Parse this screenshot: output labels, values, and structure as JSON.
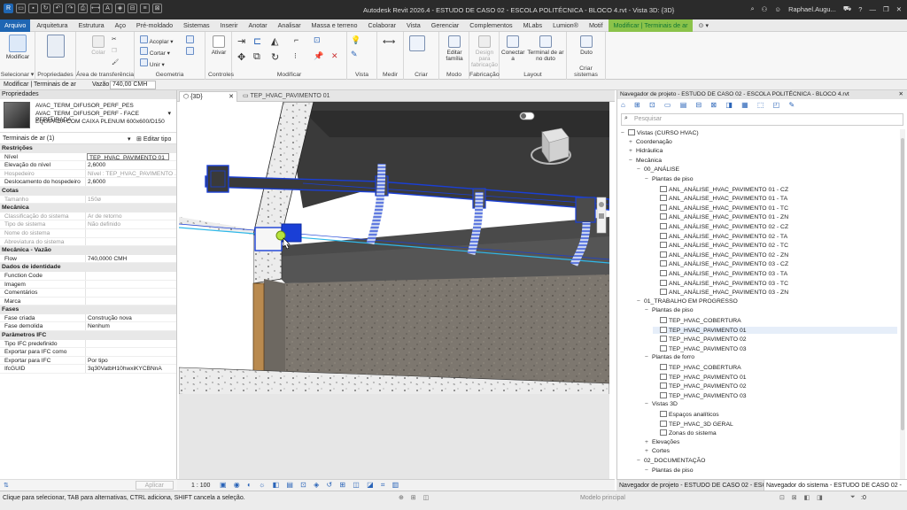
{
  "window": {
    "title": "Autodesk Revit 2026.4 - ESTUDO DE CASO 02 - ESCOLA POLITÉCNICA - BLOCO 4.rvt - Vista 3D: {3D}",
    "user": "Raphael.Augu..."
  },
  "menu": {
    "tabs": [
      "Arquivo",
      "Arquitetura",
      "Estrutura",
      "Aço",
      "Pré-moldado",
      "Sistemas",
      "Inserir",
      "Anotar",
      "Analisar",
      "Massa e terreno",
      "Colaborar",
      "Vista",
      "Gerenciar",
      "Complementos",
      "MLabs",
      "Lumion®",
      "Motif",
      "Modificar | Terminais de ar"
    ]
  },
  "ribbon": {
    "modify": "Modificar",
    "select": "Selecionar",
    "properties": "Propriedades",
    "clipboard": "Área de transferência",
    "geometry": "Geometria",
    "controls": "Controles",
    "modify_group": "Modificar",
    "view": "Vista",
    "measure": "Medir",
    "create": "Criar",
    "mode": "Modo",
    "fabrication": "Fabricação",
    "layout": "Layout",
    "create_systems": "Criar sistemas",
    "cut": "Cortar",
    "join": "Unir",
    "paste": "Colar",
    "copy": "Acoplar",
    "activate": "Ativar",
    "edit_family": "Editar família",
    "design_fab": "Design para fabricação",
    "connect_to": "Conectar a",
    "terminal_duct": "Terminal de ar no duto",
    "duct": "Duto"
  },
  "optionbar": {
    "context": "Modificar | Terminais de ar",
    "flow_label": "Vazão:",
    "flow_value": "740,00 CMH"
  },
  "properties": {
    "panel_title": "Propriedades",
    "family_line1": "AVAC_TERM_DIFUSOR_PERF_PES",
    "family_line2": "AVAC_TERM_DIFUSOR_PERF - FACE PERFURADA",
    "family_line3": "EQUIPADA COM CAIXA PLENUM 600x600/D150",
    "instance_filter": "Terminais de ar (1)",
    "edit_type": "Editar tipo",
    "rows": [
      {
        "type": "section",
        "k": "Restrições"
      },
      {
        "k": "Nível",
        "v": "TEP_HVAC_PAVIMENTO 01",
        "box": true
      },
      {
        "k": "Elevação do nível",
        "v": "2,6000"
      },
      {
        "k": "Hospedeiro",
        "v": "Nível : TEP_HVAC_PAVIMENTO ...",
        "dis": true
      },
      {
        "k": "Deslocamento do hospedeiro",
        "v": "2,6000"
      },
      {
        "type": "section",
        "k": "Cotas"
      },
      {
        "k": "Tamanho",
        "v": "150ø",
        "dis": true
      },
      {
        "type": "section",
        "k": "Mecânica"
      },
      {
        "k": "Classificação do sistema",
        "v": "Ar de retorno",
        "dis": true
      },
      {
        "k": "Tipo de sistema",
        "v": "Não definido",
        "dis": true
      },
      {
        "k": "Nome do sistema",
        "v": "",
        "dis": true
      },
      {
        "k": "Abreviatura do sistema",
        "v": "",
        "dis": true
      },
      {
        "type": "section",
        "k": "Mecânica - Vazão"
      },
      {
        "k": "Flow",
        "v": "740,0000 CMH"
      },
      {
        "type": "section",
        "k": "Dados de identidade"
      },
      {
        "k": "Function Code",
        "v": ""
      },
      {
        "k": "Imagem",
        "v": ""
      },
      {
        "k": "Comentários",
        "v": ""
      },
      {
        "k": "Marca",
        "v": ""
      },
      {
        "type": "section",
        "k": "Fases"
      },
      {
        "k": "Fase criada",
        "v": "Construção nova"
      },
      {
        "k": "Fase demolida",
        "v": "Nenhum"
      },
      {
        "type": "section",
        "k": "Parâmetros IFC"
      },
      {
        "k": "Tipo IFC predefinido",
        "v": ""
      },
      {
        "k": "Exportar para IFC como",
        "v": ""
      },
      {
        "k": "Exportar para IFC",
        "v": "Por tipo"
      },
      {
        "k": "IfcGUID",
        "v": "3q30VatbH10hwxiKYCBNnA"
      }
    ],
    "apply": "Aplicar"
  },
  "views": {
    "tab1": "{3D}",
    "tab2": "TEP_HVAC_PAVIMENTO 01",
    "scale": "1 : 100"
  },
  "browser": {
    "title": "Navegador de projeto - ESTUDO DE CASO 02 - ESCOLA POLITÉCNICA - BLOCO 4.rvt",
    "search_placeholder": "Pesquisar",
    "nodes": [
      {
        "lvl": 0,
        "exp": "−",
        "t": "Vistas (CURSO HVAC)",
        "ico": true
      },
      {
        "lvl": 1,
        "exp": "+",
        "t": "Coordenação"
      },
      {
        "lvl": 1,
        "exp": "+",
        "t": "Hidráulica"
      },
      {
        "lvl": 1,
        "exp": "−",
        "t": "Mecânica"
      },
      {
        "lvl": 2,
        "exp": "−",
        "t": "00_ANÁLISE"
      },
      {
        "lvl": 3,
        "exp": "−",
        "t": "Plantas de piso"
      },
      {
        "lvl": 4,
        "exp": "",
        "t": "ANL_ANÁLISE_HVAC_PAVIMENTO 01 - CZ",
        "ico": true
      },
      {
        "lvl": 4,
        "exp": "",
        "t": "ANL_ANÁLISE_HVAC_PAVIMENTO 01 - TA",
        "ico": true
      },
      {
        "lvl": 4,
        "exp": "",
        "t": "ANL_ANÁLISE_HVAC_PAVIMENTO 01 - TC",
        "ico": true
      },
      {
        "lvl": 4,
        "exp": "",
        "t": "ANL_ANÁLISE_HVAC_PAVIMENTO 01 - ZN",
        "ico": true
      },
      {
        "lvl": 4,
        "exp": "",
        "t": "ANL_ANÁLISE_HVAC_PAVIMENTO 02 - CZ",
        "ico": true
      },
      {
        "lvl": 4,
        "exp": "",
        "t": "ANL_ANÁLISE_HVAC_PAVIMENTO 02 - TA",
        "ico": true
      },
      {
        "lvl": 4,
        "exp": "",
        "t": "ANL_ANÁLISE_HVAC_PAVIMENTO 02 - TC",
        "ico": true
      },
      {
        "lvl": 4,
        "exp": "",
        "t": "ANL_ANÁLISE_HVAC_PAVIMENTO 02 - ZN",
        "ico": true
      },
      {
        "lvl": 4,
        "exp": "",
        "t": "ANL_ANÁLISE_HVAC_PAVIMENTO 03 - CZ",
        "ico": true
      },
      {
        "lvl": 4,
        "exp": "",
        "t": "ANL_ANÁLISE_HVAC_PAVIMENTO 03 - TA",
        "ico": true
      },
      {
        "lvl": 4,
        "exp": "",
        "t": "ANL_ANÁLISE_HVAC_PAVIMENTO 03 - TC",
        "ico": true
      },
      {
        "lvl": 4,
        "exp": "",
        "t": "ANL_ANÁLISE_HVAC_PAVIMENTO 03 - ZN",
        "ico": true
      },
      {
        "lvl": 2,
        "exp": "−",
        "t": "01_TRABALHO EM PROGRESSO"
      },
      {
        "lvl": 3,
        "exp": "−",
        "t": "Plantas de piso"
      },
      {
        "lvl": 4,
        "exp": "",
        "t": "TEP_HVAC_COBERTURA",
        "ico": true
      },
      {
        "lvl": 4,
        "exp": "",
        "t": "TEP_HVAC_PAVIMENTO 01",
        "ico": true,
        "sel": true
      },
      {
        "lvl": 4,
        "exp": "",
        "t": "TEP_HVAC_PAVIMENTO 02",
        "ico": true
      },
      {
        "lvl": 4,
        "exp": "",
        "t": "TEP_HVAC_PAVIMENTO 03",
        "ico": true
      },
      {
        "lvl": 3,
        "exp": "−",
        "t": "Plantas de forro"
      },
      {
        "lvl": 4,
        "exp": "",
        "t": "TEP_HVAC_COBERTURA",
        "ico": true
      },
      {
        "lvl": 4,
        "exp": "",
        "t": "TEP_HVAC_PAVIMENTO 01",
        "ico": true
      },
      {
        "lvl": 4,
        "exp": "",
        "t": "TEP_HVAC_PAVIMENTO 02",
        "ico": true
      },
      {
        "lvl": 4,
        "exp": "",
        "t": "TEP_HVAC_PAVIMENTO 03",
        "ico": true
      },
      {
        "lvl": 3,
        "exp": "−",
        "t": "Vistas 3D"
      },
      {
        "lvl": 4,
        "exp": "",
        "t": "Espaços analíticos",
        "ico": true
      },
      {
        "lvl": 4,
        "exp": "",
        "t": "TEP_HVAC_3D GERAL",
        "ico": true
      },
      {
        "lvl": 4,
        "exp": "",
        "t": "Zonas do sistema",
        "ico": true
      },
      {
        "lvl": 3,
        "exp": "+",
        "t": "Elevações"
      },
      {
        "lvl": 3,
        "exp": "+",
        "t": "Cortes"
      },
      {
        "lvl": 2,
        "exp": "−",
        "t": "02_DOCUMENTAÇÃO"
      },
      {
        "lvl": 3,
        "exp": "−",
        "t": "Plantas de piso"
      }
    ],
    "tab_left": "Navegador de projeto - ESTUDO DE CASO 02 - ESCOL...",
    "tab_right": "Navegador do sistema - ESTUDO DE CASO 02 - ESCO..."
  },
  "status": {
    "message": "Clique para selecionar, TAB para alternativas, CTRL adiciona, SHIFT cancela a seleção.",
    "model": "Modelo principal",
    "counter": ":0"
  },
  "colors": {
    "accent": "#1f66b3",
    "context_tab": "#8bc34a",
    "duct_blue": "#1a3fd6",
    "selection_green": "#b7e33d"
  }
}
